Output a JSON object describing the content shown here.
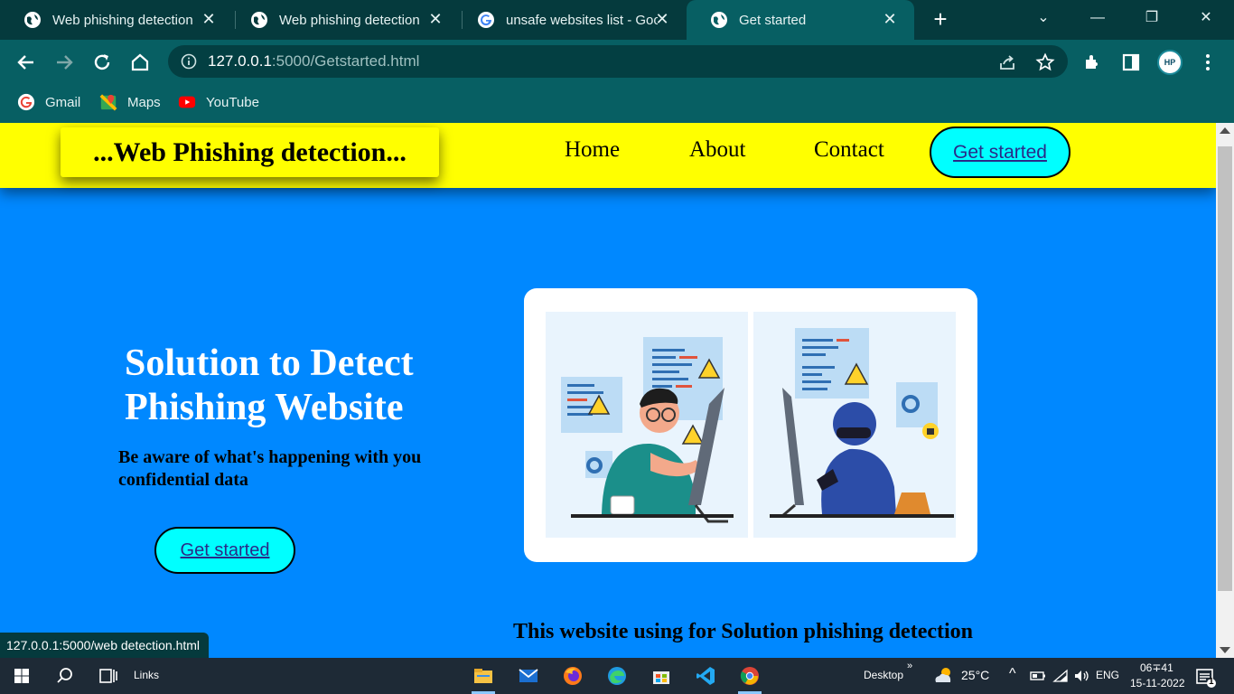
{
  "browser": {
    "tabs": [
      {
        "title": "Web phishing detection",
        "icon": "globe-icon",
        "active": false
      },
      {
        "title": "Web phishing detection",
        "icon": "globe-icon",
        "active": false
      },
      {
        "title": "unsafe websites list - Goo",
        "icon": "google-icon",
        "active": false
      },
      {
        "title": "Get started",
        "icon": "globe-icon",
        "active": true
      }
    ],
    "address": {
      "host": "127.0.0.1",
      "path": ":5000/Getstarted.html"
    },
    "bookmarks": [
      {
        "label": "Gmail",
        "icon": "google-icon"
      },
      {
        "label": "Maps",
        "icon": "maps-icon"
      },
      {
        "label": "YouTube",
        "icon": "youtube-icon"
      }
    ],
    "profile_initials": "HP",
    "status_url": "127.0.0.1:5000/web detection.html"
  },
  "site": {
    "logo": "...Web Phishing detection...",
    "nav": [
      "Home",
      "About",
      "Contact"
    ],
    "cta_top": "Get started",
    "hero_title": "Solution to Detect Phishing Website",
    "hero_subtitle": "Be aware of what's happening with you confidential data",
    "cta_hero": "Get started",
    "bottom_text": "This website using for Solution phishing detection",
    "colors": {
      "header": "#ffff00",
      "background": "#0088ff",
      "button": "#00ffff"
    }
  },
  "taskbar": {
    "links_label": "Links",
    "desktop_label": "Desktop",
    "weather": "25°C",
    "language": "ENG",
    "time": "06∓41",
    "date": "15-11-2022",
    "notification_count": "1"
  }
}
